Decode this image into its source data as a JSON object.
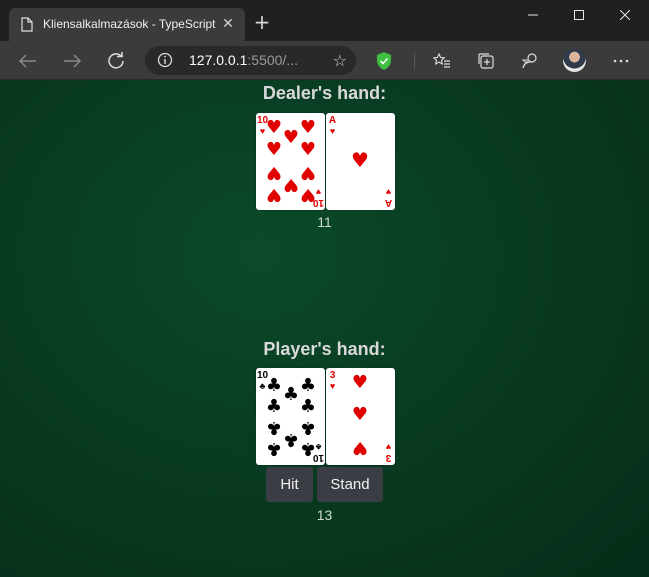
{
  "browser": {
    "tab_title": "Kliensalkalmazások - TypeScript",
    "url_host": "127.0.0.1",
    "url_rest": ":5500/..."
  },
  "dealer": {
    "title": "Dealer's hand:",
    "score": "11",
    "cards": [
      {
        "rank": "10",
        "suit": "♥",
        "color": "#e00000"
      },
      {
        "rank": "A",
        "suit": "♥",
        "color": "#e00000"
      }
    ]
  },
  "player": {
    "title": "Player's hand:",
    "score": "13",
    "cards": [
      {
        "rank": "10",
        "suit": "♣",
        "color": "#000000"
      },
      {
        "rank": "3",
        "suit": "♥",
        "color": "#e00000"
      }
    ]
  },
  "controls": {
    "hit_label": "Hit",
    "stand_label": "Stand"
  }
}
